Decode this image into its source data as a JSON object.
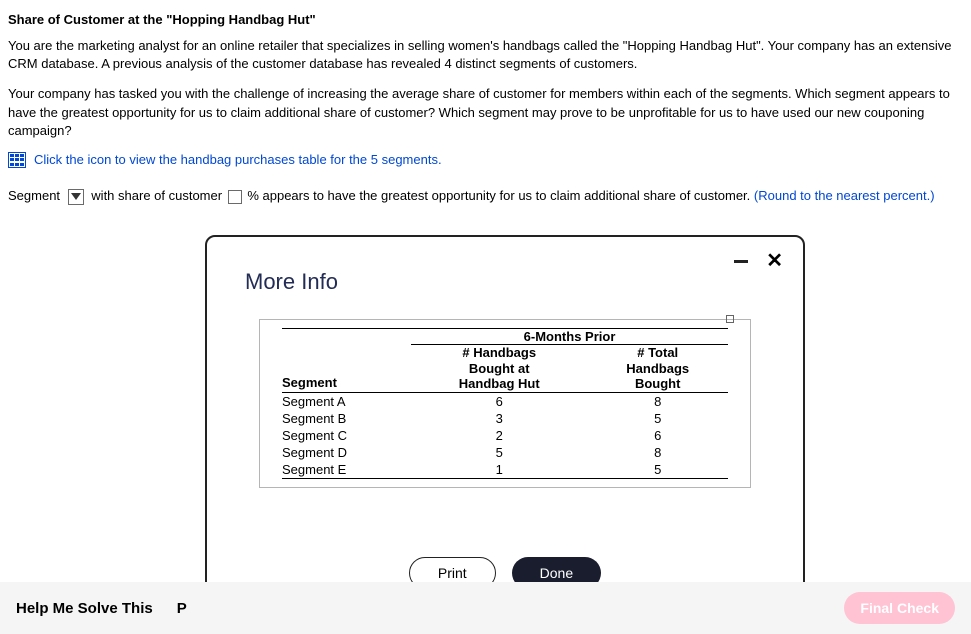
{
  "title": "Share of Customer at the \"Hopping Handbag Hut\"",
  "para1": "You are the marketing analyst for an online retailer that specializes in selling women's handbags called the \"Hopping Handbag Hut\". Your company has an extensive CRM database. A previous analysis of the customer database has revealed 4 distinct segments of customers.",
  "para2": "Your company has tasked you with the challenge of increasing the average share of customer for members within each of the segments. Which segment appears to have the greatest opportunity for us to claim additional share of customer? Which segment may prove to be unprofitable for us to have used our new couponing campaign?",
  "view_link": "Click the icon to view the handbag purchases table for the 5 segments.",
  "answer": {
    "pre": "Segment",
    "mid1": "with share of customer",
    "mid2": "% appears to have the greatest opportunity for us to claim additional share of customer.",
    "hint": "(Round to the nearest percent.)"
  },
  "modal": {
    "title": "More Info",
    "super_header": "6-Months Prior",
    "col_segment": "Segment",
    "col_hut": "# Handbags Bought at Handbag Hut",
    "col_total": "# Total Handbags Bought",
    "rows": [
      {
        "name": "Segment A",
        "hut": "6",
        "total": "8"
      },
      {
        "name": "Segment B",
        "hut": "3",
        "total": "5"
      },
      {
        "name": "Segment C",
        "hut": "2",
        "total": "6"
      },
      {
        "name": "Segment D",
        "hut": "5",
        "total": "8"
      },
      {
        "name": "Segment E",
        "hut": "1",
        "total": "5"
      }
    ],
    "print": "Print",
    "done": "Done"
  },
  "footer": {
    "help": "Help Me Solve This",
    "p": "P",
    "final": "Final Check"
  },
  "chart_data": {
    "type": "table",
    "title": "6-Months Prior",
    "columns": [
      "Segment",
      "# Handbags Bought at Handbag Hut",
      "# Total Handbags Bought"
    ],
    "rows": [
      [
        "Segment A",
        6,
        8
      ],
      [
        "Segment B",
        3,
        5
      ],
      [
        "Segment C",
        2,
        6
      ],
      [
        "Segment D",
        5,
        8
      ],
      [
        "Segment E",
        1,
        5
      ]
    ]
  }
}
